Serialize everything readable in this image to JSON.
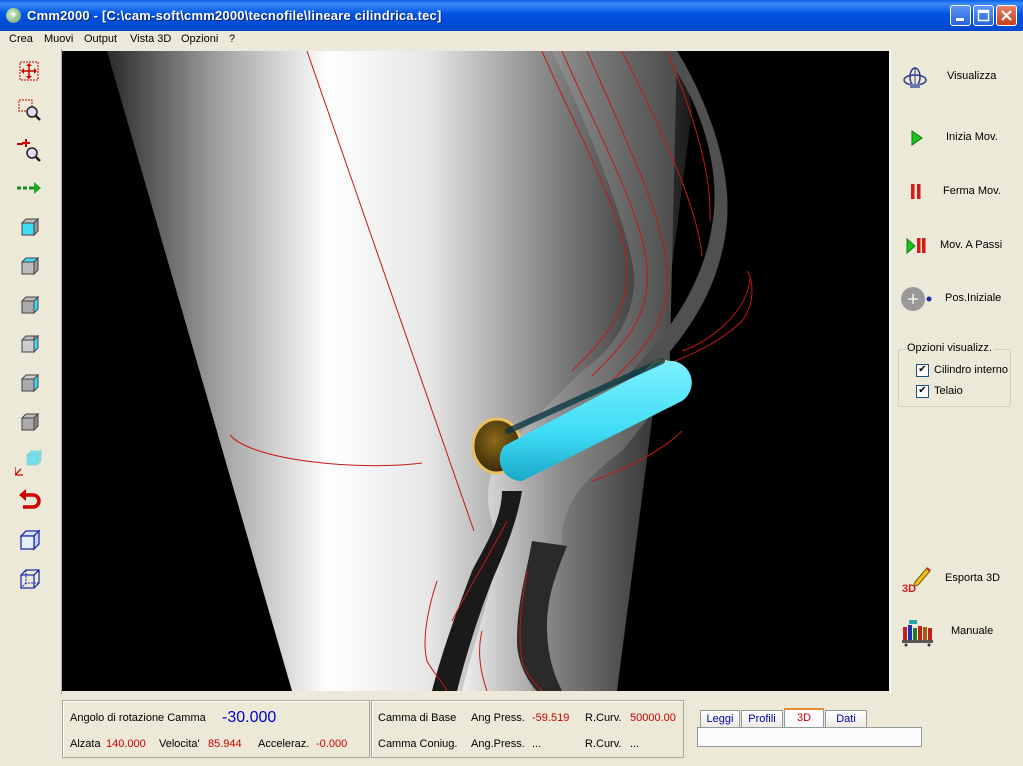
{
  "window": {
    "title": "Cmm2000 - [C:\\cam-soft\\cmm2000\\tecnofile\\lineare cilindrica.tec]",
    "app_icon": "plus-icon"
  },
  "menu": [
    "Crea",
    "Muovi",
    "Output",
    "Vista 3D",
    "Opzioni",
    "?"
  ],
  "left_toolbar": [
    "move-cross-icon",
    "zoom-window-icon",
    "zoom-in-out-icon",
    "pan-arrow-icon",
    "cube-front-icon",
    "cube-top-icon",
    "cube-left-icon",
    "cube-right-icon",
    "cube-bottom-icon",
    "cube-back-icon",
    "axes-cube-icon",
    "rotate-back-icon",
    "cube-shaded-icon",
    "cube-wireframe-icon"
  ],
  "right_panel": {
    "buttons": [
      {
        "label": "Visualizza",
        "icon": "gyroscope-icon"
      },
      {
        "label": "Inizia Mov.",
        "icon": "play-icon"
      },
      {
        "label": "Ferma Mov.",
        "icon": "pause-icon"
      },
      {
        "label": "Mov. A Passi",
        "icon": "step-icon"
      },
      {
        "label": "Pos.Iniziale",
        "icon": "home-position-icon"
      }
    ],
    "options_title": "Opzioni visualizz.",
    "options": [
      {
        "label": "Cilindro interno",
        "checked": true
      },
      {
        "label": "Telaio",
        "checked": true
      }
    ],
    "export_label": "Esporta 3D",
    "manual_label": "Manuale"
  },
  "status": {
    "rotation_label": "Angolo di rotazione Camma",
    "rotation_value": "-30.000",
    "lift_label": "Alzata",
    "lift_value": "140.000",
    "velocity_label": "Velocita'",
    "velocity_value": "85.944",
    "accel_label": "Acceleraz.",
    "accel_value": "-0.000",
    "base_cam_label": "Camma di Base",
    "base_press_label": "Ang Press.",
    "base_press_value": "-59.519",
    "base_curv_label": "R.Curv.",
    "base_curv_value": "50000.00",
    "conj_cam_label": "Camma Coniug.",
    "conj_press_label": "Ang.Press.",
    "conj_press_value": "...",
    "conj_curv_label": "R.Curv.",
    "conj_curv_value": "..."
  },
  "tabs": [
    {
      "label": "Leggi",
      "active": false
    },
    {
      "label": "Profili",
      "active": false
    },
    {
      "label": "3D",
      "active": true
    },
    {
      "label": "Dati",
      "active": false
    }
  ],
  "colors": {
    "titlebar": "#0054e3",
    "viewport_bg": "#000000",
    "value_red": "#cc0000",
    "value_blue": "#0000cc",
    "follower_cyan": "#3fdcf6"
  }
}
